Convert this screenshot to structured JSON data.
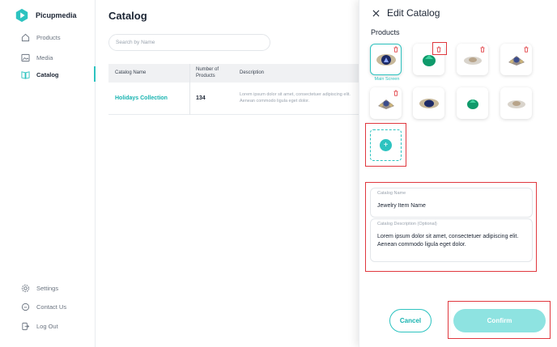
{
  "sidebar": {
    "brand": "Picupmedia",
    "items": [
      {
        "label": "Products",
        "icon": "home-icon"
      },
      {
        "label": "Media",
        "icon": "image-icon"
      },
      {
        "label": "Catalog",
        "icon": "book-icon",
        "active": true
      }
    ],
    "bottom_items": [
      {
        "label": "Settings",
        "icon": "gear-icon"
      },
      {
        "label": "Contact Us",
        "icon": "chat-icon"
      },
      {
        "label": "Log Out",
        "icon": "logout-icon"
      }
    ]
  },
  "main": {
    "title": "Catalog",
    "search_placeholder": "Search by Name",
    "table": {
      "headers": [
        "Catalog Name",
        "Number of Products",
        "Description"
      ],
      "rows": [
        {
          "name": "Holidays Collection",
          "count": "134",
          "description": "Lorem ipsum dolor sit amet, consectetuer adipiscing elit. Aenean commodo ligula eget dolor."
        }
      ]
    }
  },
  "panel": {
    "title": "Edit Catalog",
    "products_label": "Products",
    "main_screen_label": "Main Screen",
    "catalog_name_label": "Catalog Name",
    "catalog_name_value": "Jewelry Item Name",
    "catalog_desc_label": "Catalog Description (Optional)",
    "catalog_desc_value": "Lorem ipsum dolor sit amet, consectetuer adipiscing elit. Aenean commodo ligula eget dolor.",
    "add_symbol": "+",
    "cancel_label": "Cancel",
    "confirm_label": "Confirm"
  },
  "colors": {
    "accent": "#2dc3c0",
    "accent_light": "#8ee3e1",
    "annotation": "#e0383e",
    "text_dark": "#1b2433"
  }
}
